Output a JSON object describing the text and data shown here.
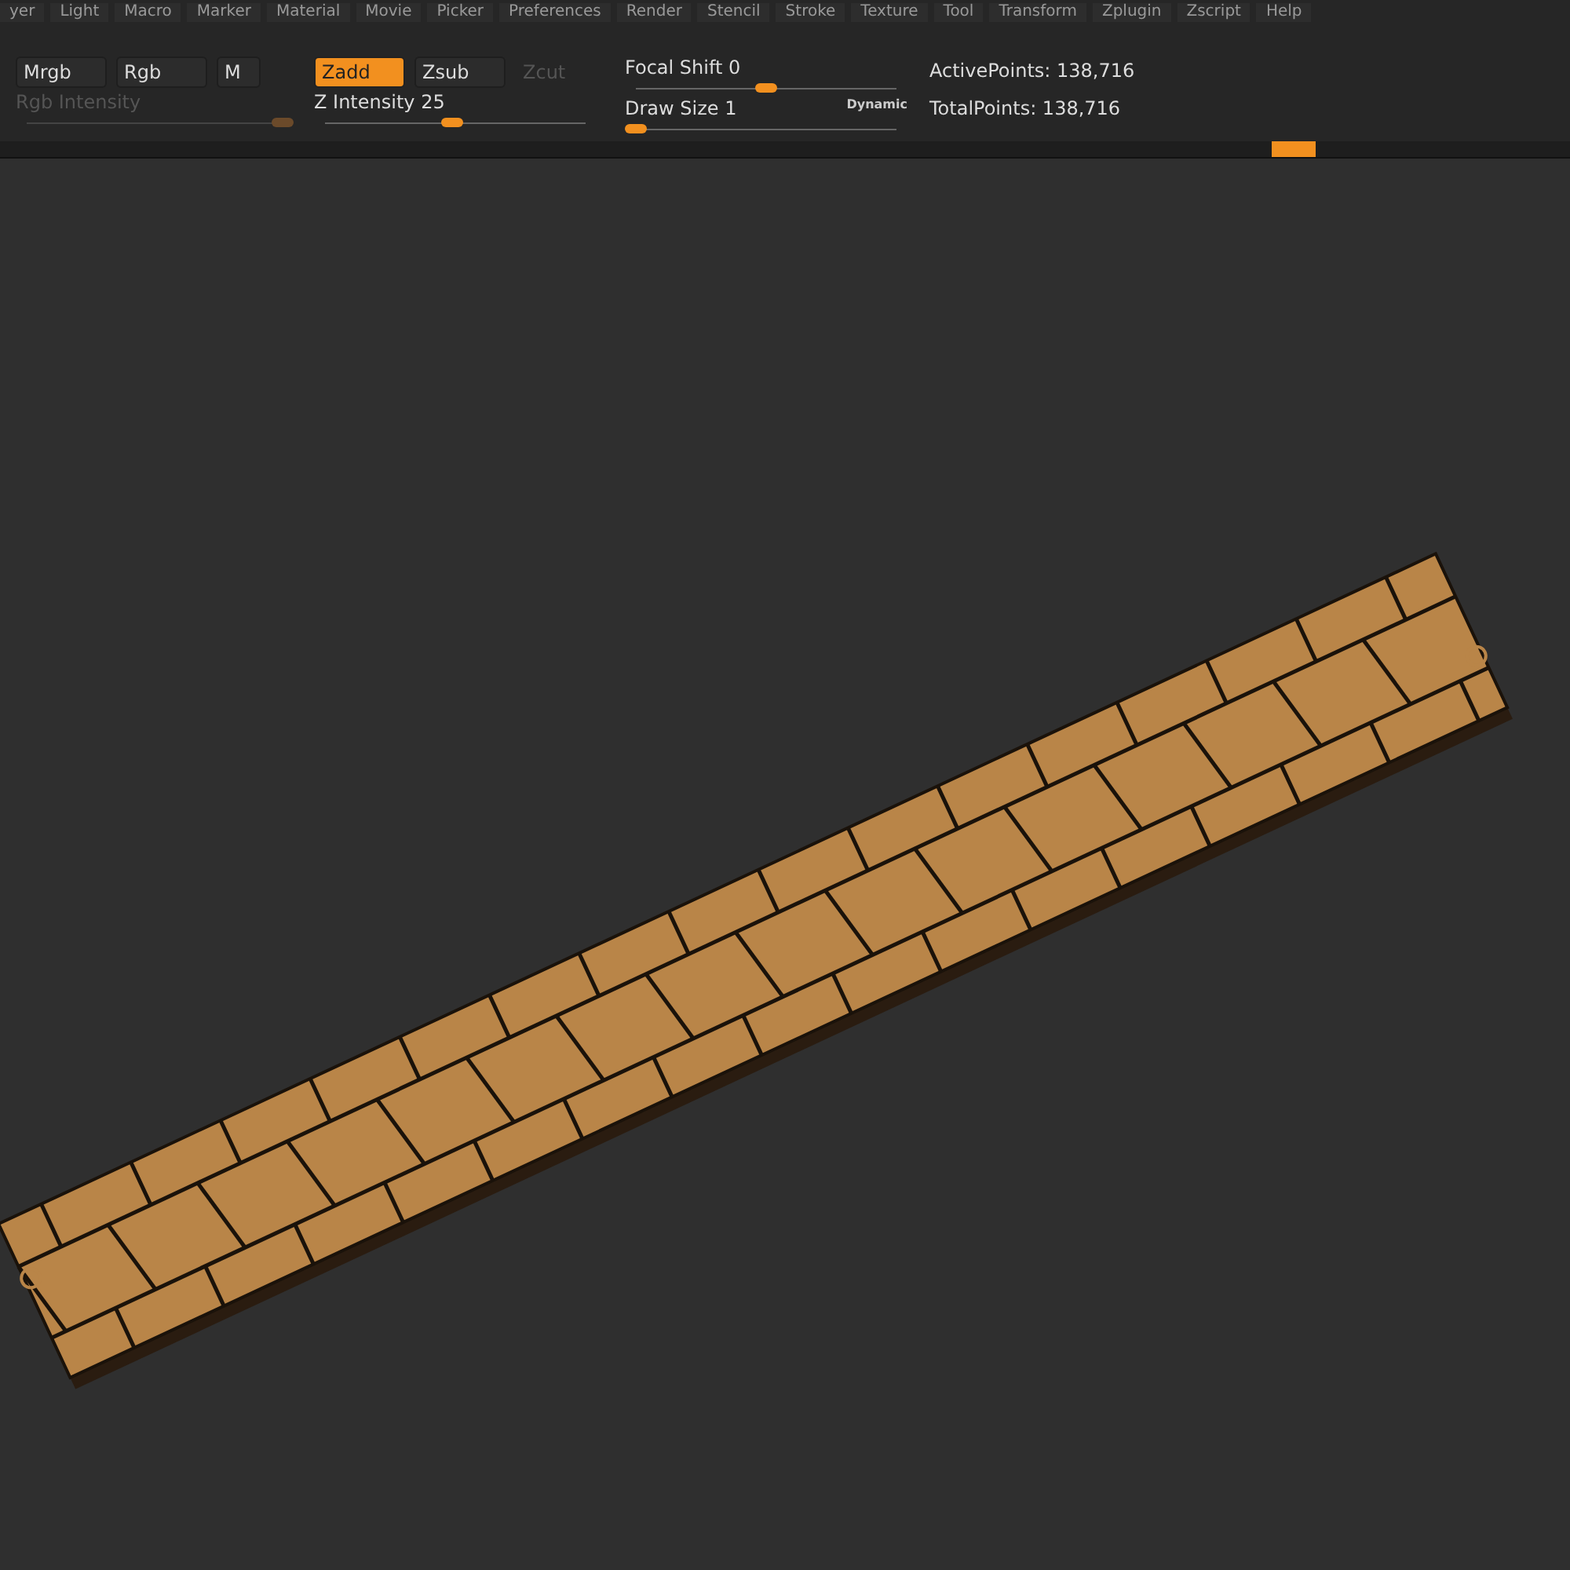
{
  "menu": [
    "yer",
    "Light",
    "Macro",
    "Marker",
    "Material",
    "Movie",
    "Picker",
    "Preferences",
    "Render",
    "Stencil",
    "Stroke",
    "Texture",
    "Tool",
    "Transform",
    "Zplugin",
    "Zscript",
    "Help"
  ],
  "color_buttons": [
    {
      "label": "Mrgb",
      "selected": false
    },
    {
      "label": "Rgb",
      "selected": false
    },
    {
      "label": "M",
      "selected": false
    }
  ],
  "mode_buttons": [
    {
      "label": "Zadd",
      "selected": true,
      "disabled": false
    },
    {
      "label": "Zsub",
      "selected": false,
      "disabled": false
    },
    {
      "label": "Zcut",
      "selected": false,
      "disabled": true
    }
  ],
  "sliders": [
    {
      "label": "Rgb Intensity",
      "level": 0.98,
      "disabled": true
    },
    {
      "label": "Z Intensity 25",
      "level": 0.49,
      "disabled": false
    },
    {
      "label": "Focal Shift 0",
      "level": 0.5,
      "disabled": false
    },
    {
      "label": "Draw Size 1",
      "level": 0.0,
      "disabled": false
    }
  ],
  "dynamic_label": "Dynamic",
  "stats": [
    "ActivePoints: 138,716",
    "TotalPoints: 138,716"
  ]
}
